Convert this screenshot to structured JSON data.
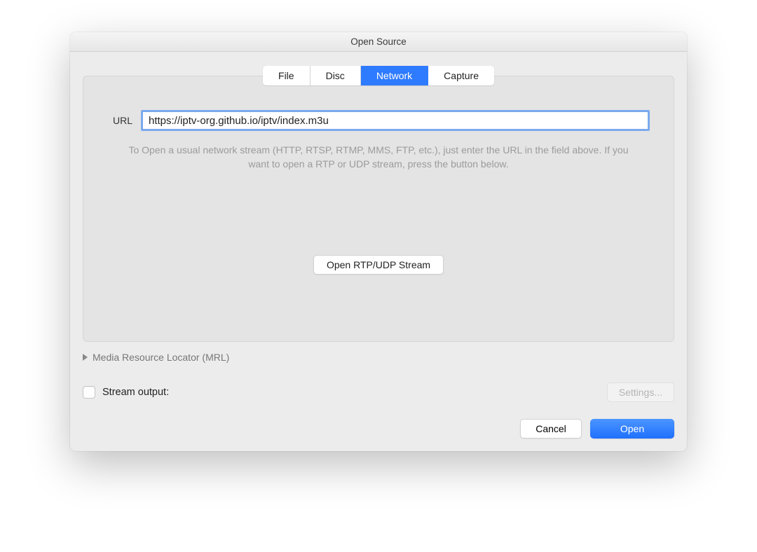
{
  "window": {
    "title": "Open Source"
  },
  "tabs": {
    "items": [
      {
        "label": "File",
        "active": false
      },
      {
        "label": "Disc",
        "active": false
      },
      {
        "label": "Network",
        "active": true
      },
      {
        "label": "Capture",
        "active": false
      }
    ]
  },
  "network": {
    "url_label": "URL",
    "url_value": "https://iptv-org.github.io/iptv/index.m3u",
    "hint": "To Open a usual network stream (HTTP, RTSP, RTMP, MMS, FTP, etc.), just enter the URL in the field above. If you want to open a RTP or UDP stream, press the button below.",
    "rtp_button": "Open RTP/UDP Stream"
  },
  "mrl": {
    "label": "Media Resource Locator (MRL)"
  },
  "stream_output": {
    "label": "Stream output:",
    "checked": false,
    "settings_label": "Settings..."
  },
  "footer": {
    "cancel": "Cancel",
    "open": "Open"
  }
}
